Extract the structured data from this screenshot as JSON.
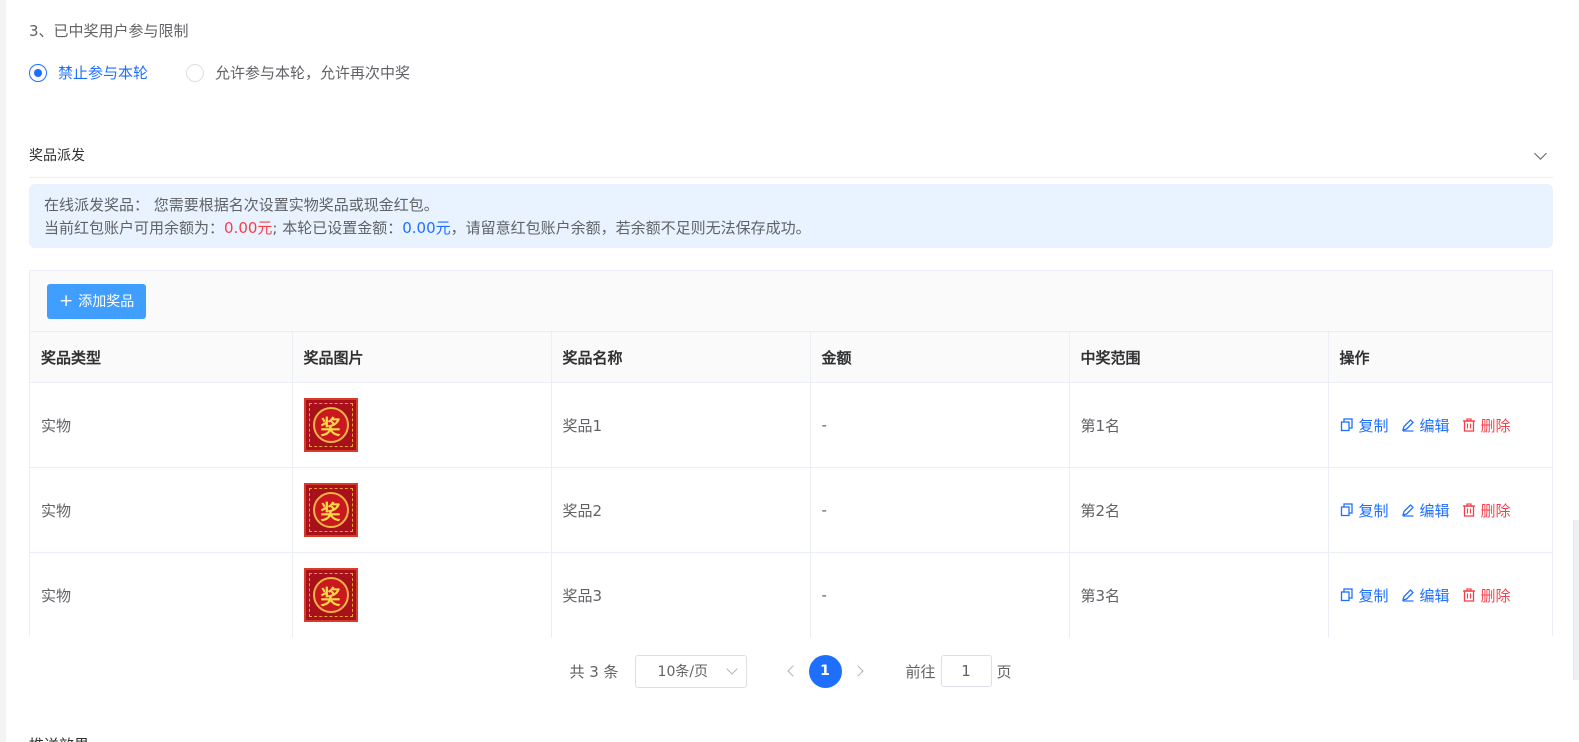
{
  "participation": {
    "label": "3、已中奖用户参与限制",
    "options": [
      {
        "label": "禁止参与本轮",
        "checked": true
      },
      {
        "label": "允许参与本轮，允许再次中奖",
        "checked": false
      }
    ]
  },
  "distribution": {
    "title": "奖品派发",
    "notice": {
      "line1": "在线派发奖品： 您需要根据名次设置实物奖品或现金红包。",
      "balance_prefix": "当前红包账户可用余额为：",
      "balance": "0.00元",
      "set_prefix": "; 本轮已设置金额：",
      "set_amount": "0.00元",
      "suffix": "，请留意红包账户余额，若余额不足则无法保存成功。"
    },
    "add_button": "添加奖品",
    "columns": [
      "奖品类型",
      "奖品图片",
      "奖品名称",
      "金额",
      "中奖范围",
      "操作"
    ],
    "rows": [
      {
        "type": "实物",
        "image_char": "奖",
        "name": "奖品1",
        "amount": "-",
        "range": "第1名"
      },
      {
        "type": "实物",
        "image_char": "奖",
        "name": "奖品2",
        "amount": "-",
        "range": "第2名"
      },
      {
        "type": "实物",
        "image_char": "奖",
        "name": "奖品3",
        "amount": "-",
        "range": "第3名"
      }
    ],
    "actions": {
      "copy": "复制",
      "edit": "编辑",
      "delete": "删除"
    }
  },
  "pagination": {
    "total": "共 3 条",
    "page_size": "10条/页",
    "current_page": "1",
    "goto_label": "前往",
    "goto_value": "1",
    "page_unit": "页"
  },
  "next_section": "推送效果"
}
